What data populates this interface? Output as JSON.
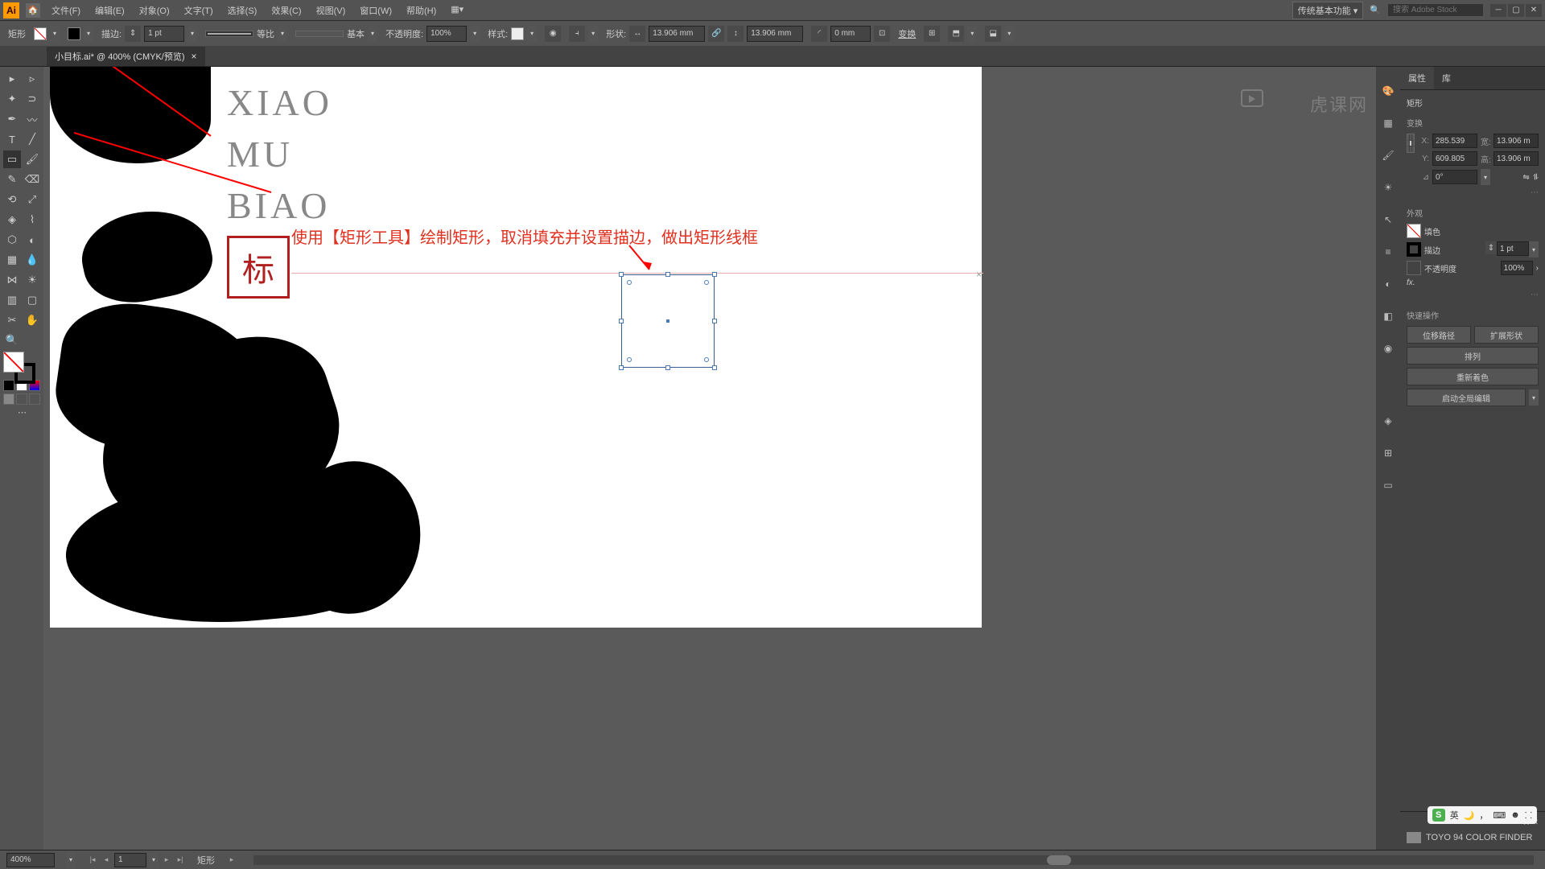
{
  "app": {
    "logo": "Ai"
  },
  "menu": [
    "文件(F)",
    "编辑(E)",
    "对象(O)",
    "文字(T)",
    "选择(S)",
    "效果(C)",
    "视图(V)",
    "窗口(W)",
    "帮助(H)"
  ],
  "titlebar": {
    "workspace": "传统基本功能",
    "search_placeholder": "搜索 Adobe Stock"
  },
  "controlbar": {
    "sel_label": "矩形",
    "stroke_label": "描边:",
    "stroke_weight": "1 pt",
    "profile_label": "等比",
    "brush_label": "基本",
    "opacity_label": "不透明度:",
    "opacity": "100%",
    "style_label": "样式:",
    "shape_label": "形状:",
    "w": "13.906 mm",
    "h": "13.906 mm",
    "corner": "0 mm",
    "transform_label": "变换"
  },
  "doctab": {
    "title": "小目标.ai* @ 400% (CMYK/预览)"
  },
  "canvas": {
    "text1": "XIAO",
    "text2": "MU",
    "text3": "BIAO",
    "seal": "标",
    "annotation": "使用【矩形工具】绘制矩形，取消填充并设置描边，做出矩形线框"
  },
  "props": {
    "tab_props": "属性",
    "tab_lib": "库",
    "obj_type": "矩形",
    "section_transform": "变换",
    "x": "285.539",
    "y": "609.805",
    "w": "13.906 m",
    "h": "13.906 m",
    "angle": "0°",
    "section_appearance": "外观",
    "fill_label": "填色",
    "stroke_label": "描边",
    "stroke_val": "1 pt",
    "opacity_label": "不透明度",
    "opacity_val": "100%",
    "section_quick": "快速操作",
    "btn_offset": "位移路径",
    "btn_expand": "扩展形状",
    "btn_arrange": "排列",
    "btn_recolor": "重新着色",
    "btn_global": "启动全局编辑"
  },
  "swatches": {
    "title": "TOYO 94 COLOR FINDER"
  },
  "status": {
    "zoom": "400%",
    "artboard": "1",
    "selection": "矩形"
  },
  "ime": {
    "lang": "英"
  },
  "watermark": "虎课网",
  "tool_icons": {
    "selection": "▸",
    "direct": "▹",
    "wand": "✦",
    "lasso": "⊃",
    "pen": "✒",
    "curve": "〰",
    "type": "T",
    "line": "╱",
    "rect": "▭",
    "brush": "🖌",
    "pencil": "✎",
    "eraser": "⌫",
    "rotate": "⟲",
    "scale": "⤢",
    "width": "◈",
    "warp": "⌇",
    "shape": "⬡",
    "gradient": "◐",
    "mesh": "▦",
    "eyedrop": "💧",
    "blend": "⋈",
    "symbol": "☀",
    "graph": "▥",
    "artb": "▢",
    "slice": "✂",
    "hand": "✋",
    "zoom": "🔍"
  }
}
